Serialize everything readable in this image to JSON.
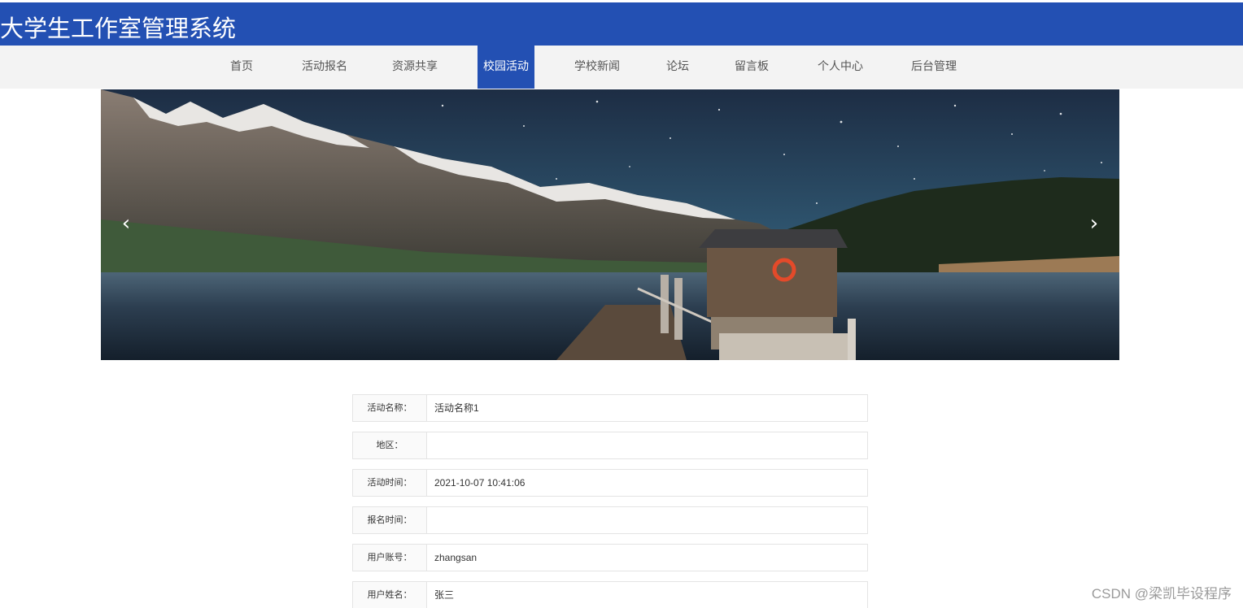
{
  "header": {
    "title": "大学生工作室管理系统",
    "bg_color": "#2350b3"
  },
  "nav": {
    "items": [
      {
        "label": "首页",
        "active": false
      },
      {
        "label": "活动报名",
        "active": false
      },
      {
        "label": "资源共享",
        "active": false
      },
      {
        "label": "校园活动",
        "active": true
      },
      {
        "label": "学校新闻",
        "active": false
      },
      {
        "label": "论坛",
        "active": false
      },
      {
        "label": "留言板",
        "active": false
      },
      {
        "label": "个人中心",
        "active": false
      },
      {
        "label": "后台管理",
        "active": false
      }
    ],
    "active_color": "#2350b3"
  },
  "banner": {
    "prev_icon": "chevron-left-icon",
    "next_icon": "chevron-right-icon",
    "prev_glyph": "‹",
    "next_glyph": "›"
  },
  "form": {
    "rows": [
      {
        "label": "活动名称：",
        "value": "活动名称1"
      },
      {
        "label": "地区：",
        "value": ""
      },
      {
        "label": "活动时间：",
        "value": "2021-10-07 10:41:06"
      },
      {
        "label": "报名时间：",
        "value": ""
      },
      {
        "label": "用户账号：",
        "value": "zhangsan"
      },
      {
        "label": "用户姓名：",
        "value": "张三"
      }
    ]
  },
  "watermark": "CSDN @梁凯毕设程序"
}
